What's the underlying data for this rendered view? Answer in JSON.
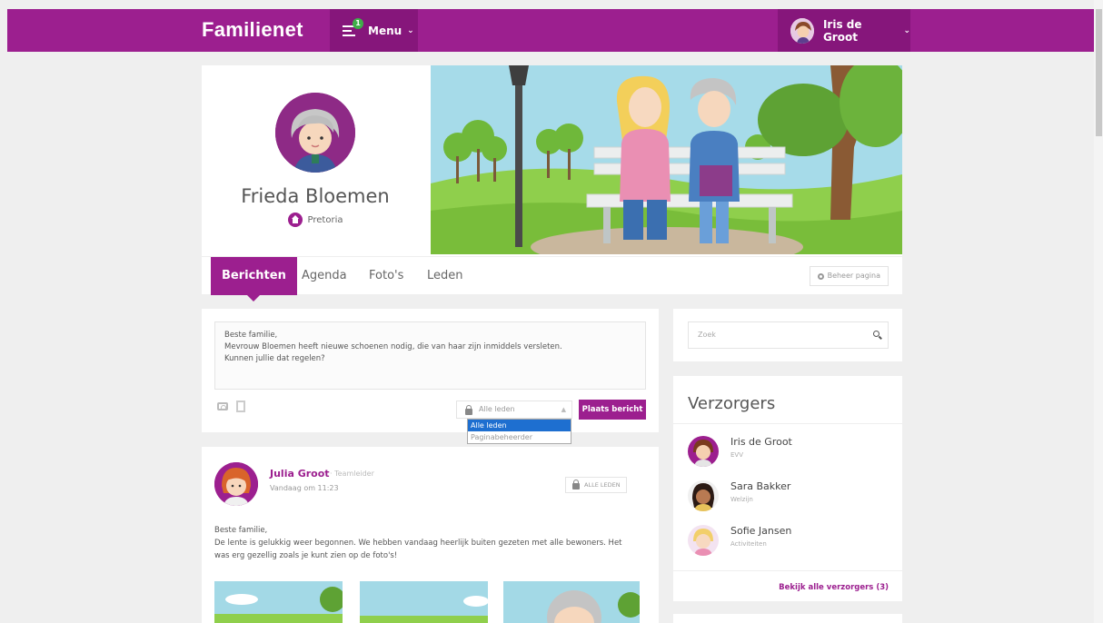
{
  "topbar": {
    "brand": "Familienet",
    "menu_label": "Menu",
    "menu_badge": "1",
    "user_name": "Iris de Groot",
    "accent_color": "#9c1f8f"
  },
  "profile": {
    "name": "Frieda Bloemen",
    "location": "Pretoria"
  },
  "tabs": [
    {
      "label": "Berichten",
      "active": true
    },
    {
      "label": "Agenda",
      "active": false
    },
    {
      "label": "Foto's",
      "active": false
    },
    {
      "label": "Leden",
      "active": false
    }
  ],
  "manage_label": "Beheer pagina",
  "composer": {
    "lines": [
      "Beste familie,",
      "Mevrouw Bloemen heeft nieuwe schoenen nodig, die van haar zijn inmiddels versleten.",
      "Kunnen jullie dat regelen?"
    ],
    "audience_value": "Alle leden",
    "audience_options": [
      "Alle leden",
      "Paginabeheerder"
    ],
    "post_button": "Plaats bericht"
  },
  "post": {
    "author": "Julia Groot",
    "role": "Teamleider",
    "time": "Vandaag om 11:23",
    "audience": "ALLE LEDEN",
    "lines": [
      "Beste familie,",
      "De lente is gelukkig weer begonnen. We hebben vandaag heerlijk buiten gezeten met alle bewoners. Het",
      "was erg gezellig zoals je kunt zien op de foto's!"
    ]
  },
  "search": {
    "placeholder": "Zoek"
  },
  "caregivers": {
    "title": "Verzorgers",
    "items": [
      {
        "name": "Iris de Groot",
        "role": "EVV"
      },
      {
        "name": "Sara Bakker",
        "role": "Welzijn"
      },
      {
        "name": "Sofie Jansen",
        "role": "Activiteiten"
      }
    ],
    "link": "Bekijk alle verzorgers (3)"
  }
}
